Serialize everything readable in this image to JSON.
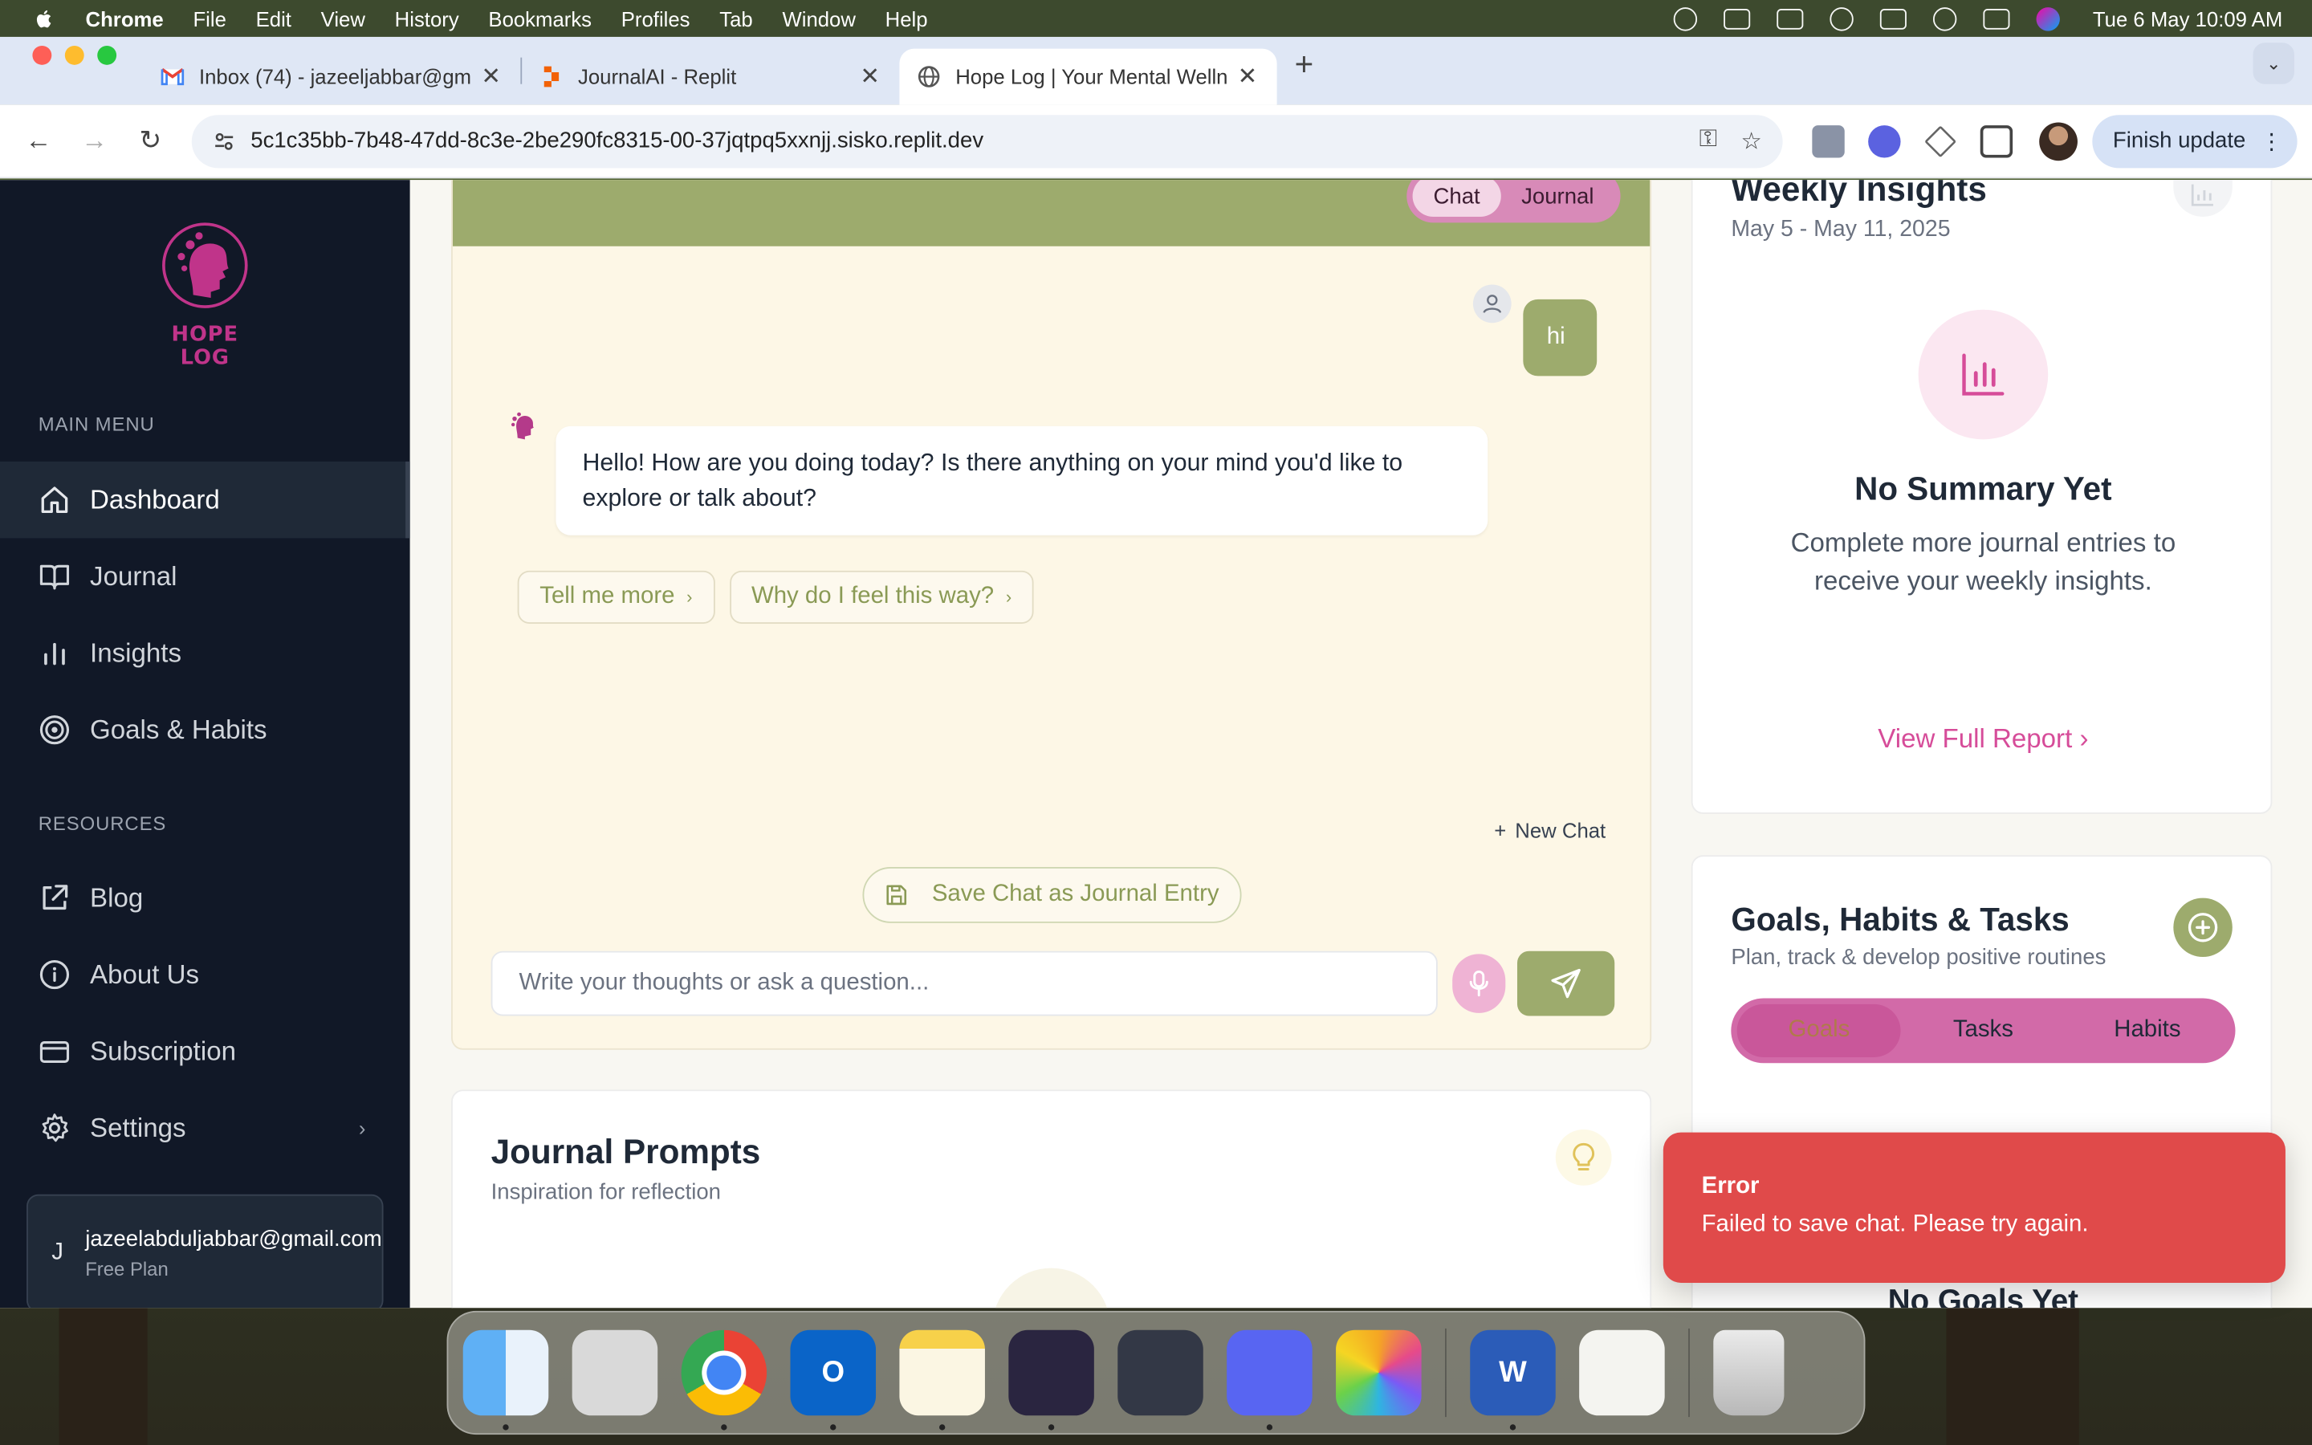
{
  "menubar": {
    "app_name": "Chrome",
    "menus": [
      "File",
      "Edit",
      "View",
      "History",
      "Bookmarks",
      "Profiles",
      "Tab",
      "Window",
      "Help"
    ],
    "clock": "Tue 6 May  10:09 AM"
  },
  "browser": {
    "tabs": [
      {
        "title": "Inbox (74) - jazeeljabbar@gm",
        "icon": "gmail-icon"
      },
      {
        "title": "JournalAI - Replit",
        "icon": "replit-icon"
      },
      {
        "title": "Hope Log | Your Mental Welln",
        "icon": "globe-icon"
      }
    ],
    "url": "5c1c35bb-7b48-47dd-8c3e-2be290fc8315-00-37jqtpq5xxnjj.sisko.replit.dev",
    "finish_update": "Finish update"
  },
  "sidebar": {
    "logo_text": "HOPE LOG",
    "main_menu_label": "MAIN MENU",
    "main_items": [
      {
        "label": "Dashboard",
        "icon": "home-icon",
        "active": true
      },
      {
        "label": "Journal",
        "icon": "book-icon"
      },
      {
        "label": "Insights",
        "icon": "bar-chart-icon"
      },
      {
        "label": "Goals & Habits",
        "icon": "target-icon"
      }
    ],
    "resources_label": "RESOURCES",
    "resource_items": [
      {
        "label": "Blog",
        "icon": "external-link-icon"
      },
      {
        "label": "About Us",
        "icon": "info-icon"
      },
      {
        "label": "Subscription",
        "icon": "credit-card-icon"
      },
      {
        "label": "Settings",
        "icon": "gear-icon"
      }
    ],
    "user": {
      "initial": "J",
      "email": "jazeelabduljabbar@gmail.com",
      "plan": "Free Plan"
    }
  },
  "chat": {
    "toggle": {
      "chat": "Chat",
      "journal": "Journal"
    },
    "user_message": "hi",
    "ai_message": "Hello! How are you doing today? Is there anything on your mind you'd like to explore or talk about?",
    "suggestions": [
      "Tell me more",
      "Why do I feel this way?"
    ],
    "new_chat": "New Chat",
    "save_chat": "Save Chat as Journal Entry",
    "input_placeholder": "Write your thoughts or ask a question..."
  },
  "prompts": {
    "title": "Journal Prompts",
    "subtitle": "Inspiration for reflection"
  },
  "insights": {
    "title": "Weekly Insights",
    "date_range": "May 5 - May 11, 2025",
    "empty_title": "No Summary Yet",
    "empty_text": "Complete more journal entries to receive your weekly insights.",
    "view_report": "View Full Report"
  },
  "goals": {
    "title": "Goals, Habits & Tasks",
    "subtitle": "Plan, track & develop positive routines",
    "tabs": [
      "Goals",
      "Tasks",
      "Habits"
    ],
    "empty_title": "No Goals Yet"
  },
  "toast": {
    "title": "Error",
    "message": "Failed to save chat. Please try again."
  },
  "colors": {
    "accent_green": "#9dab6d",
    "accent_pink": "#d64c99",
    "sidebar_bg": "#111827",
    "error_red": "#e04a4a"
  },
  "dock": {
    "apps": [
      "finder-icon",
      "launchpad-icon",
      "chrome-icon",
      "outlook-icon",
      "notes-icon",
      "obsidian-icon",
      "copilot-icon",
      "discord-icon",
      "photos-icon",
      "word-icon",
      "textedit-icon",
      "trash-icon"
    ]
  }
}
